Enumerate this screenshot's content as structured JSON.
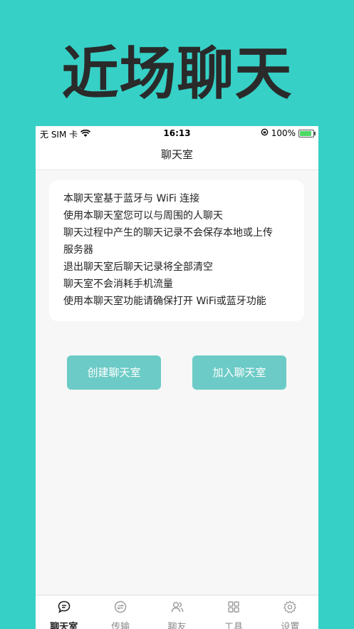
{
  "promo": {
    "headline": "近场聊天"
  },
  "status_bar": {
    "carrier": "无 SIM 卡",
    "time": "16:13",
    "battery_percent": "100%"
  },
  "nav": {
    "title": "聊天室"
  },
  "intro_card": {
    "lines": [
      "本聊天室基于蓝牙与 WiFi 连接",
      "使用本聊天室您可以与周围的人聊天",
      "聊天过程中产生的聊天记录不会保存本地或上传",
      "服务器",
      "退出聊天室后聊天记录将全部清空",
      "聊天室不会消耗手机流量",
      "使用本聊天室功能请确保打开 WiFi或蓝牙功能"
    ]
  },
  "actions": {
    "create_label": "创建聊天室",
    "join_label": "加入聊天室"
  },
  "tabbar": {
    "items": [
      {
        "label": "聊天室",
        "icon": "chat-bubble-icon",
        "active": true
      },
      {
        "label": "传输",
        "icon": "transfer-icon",
        "active": false
      },
      {
        "label": "聊友",
        "icon": "friends-icon",
        "active": false
      },
      {
        "label": "工具",
        "icon": "grid-icon",
        "active": false
      },
      {
        "label": "设置",
        "icon": "gear-icon",
        "active": false
      }
    ]
  },
  "colors": {
    "background": "#36d0c6",
    "button": "#6ccbc6",
    "headline": "#2a2a2a"
  }
}
